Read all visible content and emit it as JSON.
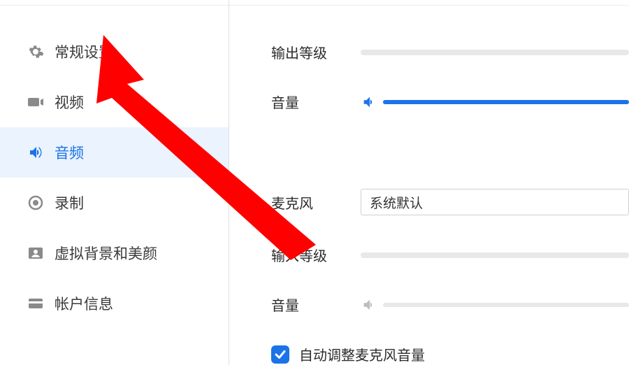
{
  "sidebar": {
    "items": [
      {
        "id": "general",
        "label": "常规设置",
        "active": false,
        "icon": "gear"
      },
      {
        "id": "video",
        "label": "视频",
        "active": false,
        "icon": "videocam"
      },
      {
        "id": "audio",
        "label": "音频",
        "active": true,
        "icon": "speaker"
      },
      {
        "id": "record",
        "label": "录制",
        "active": false,
        "icon": "record"
      },
      {
        "id": "vbg",
        "label": "虚拟背景和美颜",
        "active": false,
        "icon": "person"
      },
      {
        "id": "account",
        "label": "帐户信息",
        "active": false,
        "icon": "card"
      }
    ]
  },
  "content": {
    "output_level_label": "输出等级",
    "output_volume_label": "音量",
    "output_volume_fill_percent": 100,
    "mic_label": "麦克风",
    "mic_value": "系统默认",
    "input_level_label": "输入等级",
    "input_volume_label": "音量",
    "input_volume_fill_percent": 0,
    "auto_adjust": {
      "checked": true,
      "label": "自动调整麦克风音量"
    }
  },
  "colors": {
    "accent": "#1b73e8",
    "arrow": "#ff0000"
  }
}
